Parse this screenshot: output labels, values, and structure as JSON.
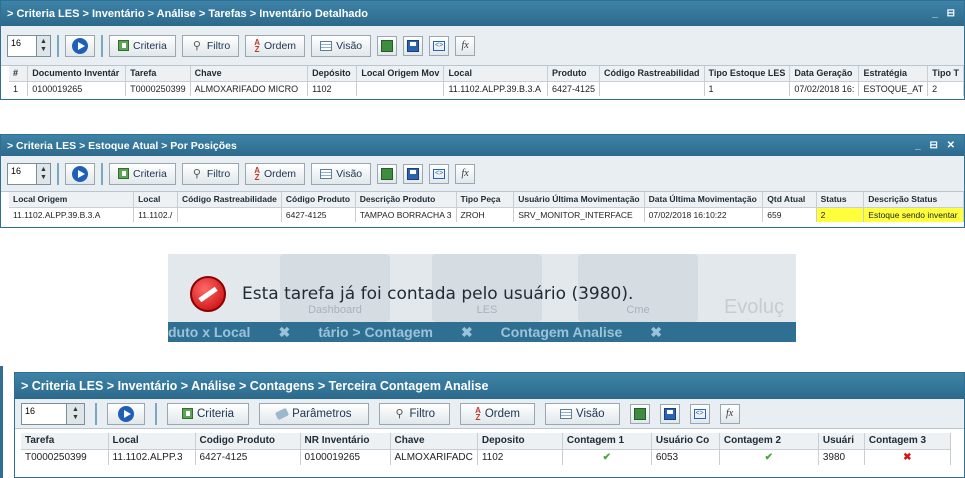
{
  "window1": {
    "title": "> Criteria LES > Inventário > Análise > Tarefas > Inventário Detalhado",
    "controls": "_ ⊟",
    "toolbar": {
      "page_size": "16",
      "criteria": "Criteria",
      "filtro": "Filtro",
      "ordem": "Ordem",
      "visao": "Visão"
    },
    "columns": [
      "#",
      "Documento Inventár",
      "Tarefa",
      "Chave",
      "Depósito",
      "Local Origem Mov",
      "Local",
      "Produto",
      "Código Rastreabilidad",
      "Tipo Estoque LES",
      "Data Geração",
      "Estratégia",
      "Tipo T"
    ],
    "rows": [
      [
        "1",
        "0100019265",
        "T0000250399",
        "ALMOXARIFADO MICRO",
        "1102",
        "",
        "11.1102.ALPP.39.B.3.A",
        "6427-4125",
        "",
        "1",
        "07/02/2018 16:",
        "ESTOQUE_AT",
        "2"
      ]
    ]
  },
  "window2": {
    "title": "> Criteria LES > Estoque Atual > Por Posições",
    "controls": "_ ⊟ ✕",
    "toolbar": {
      "page_size": "16",
      "criteria": "Criteria",
      "filtro": "Filtro",
      "ordem": "Ordem",
      "visao": "Visão"
    },
    "columns": [
      "Local Origem",
      "Local",
      "Código Rastreabilidade",
      "Código Produto",
      "Descrição Produto",
      "Tipo Peça",
      "Usuário Última Movimentação",
      "Data Última Movimentação",
      "Qtd Atual",
      "Status",
      "Descrição Status"
    ],
    "rows": [
      [
        "11.1102.ALPP.39.B.3.A",
        "11.1102./",
        "",
        "6427-4125",
        "TAMPAO BORRACHA 3",
        "ZROH",
        "SRV_MONITOR_INTERFACE",
        "07/02/2018 16:10:22",
        "659",
        "2",
        "Estoque sendo inventar"
      ]
    ]
  },
  "dialog": {
    "message": "Esta tarefa já foi contada pelo usuário (3980).",
    "bg_tiles": [
      "Dashboard",
      "LES",
      "Cme"
    ],
    "bg_right": "Evoluç",
    "bg_bottom": [
      "duto x Local",
      "tário > Contagem",
      "Contagem Analise"
    ]
  },
  "window3": {
    "title": "> Criteria LES > Inventário > Análise > Contagens > Terceira Contagem Analise",
    "toolbar": {
      "page_size": "16",
      "criteria": "Criteria",
      "parametros": "Parâmetros",
      "filtro": "Filtro",
      "ordem": "Ordem",
      "visao": "Visão"
    },
    "columns": [
      "Tarefa",
      "Local",
      "Codigo Produto",
      "NR Inventário",
      "Chave",
      "Deposito",
      "Contagem 1",
      "Usuário Co",
      "Contagem 2",
      "Usuári",
      "Contagem 3"
    ],
    "rows": [
      [
        "T0000250399",
        "11.1102.ALPP.3",
        "6427-4125",
        "0100019265",
        "ALMOXARIFADC",
        "1102",
        "✔",
        "6053",
        "✔",
        "3980",
        "✖"
      ]
    ]
  }
}
